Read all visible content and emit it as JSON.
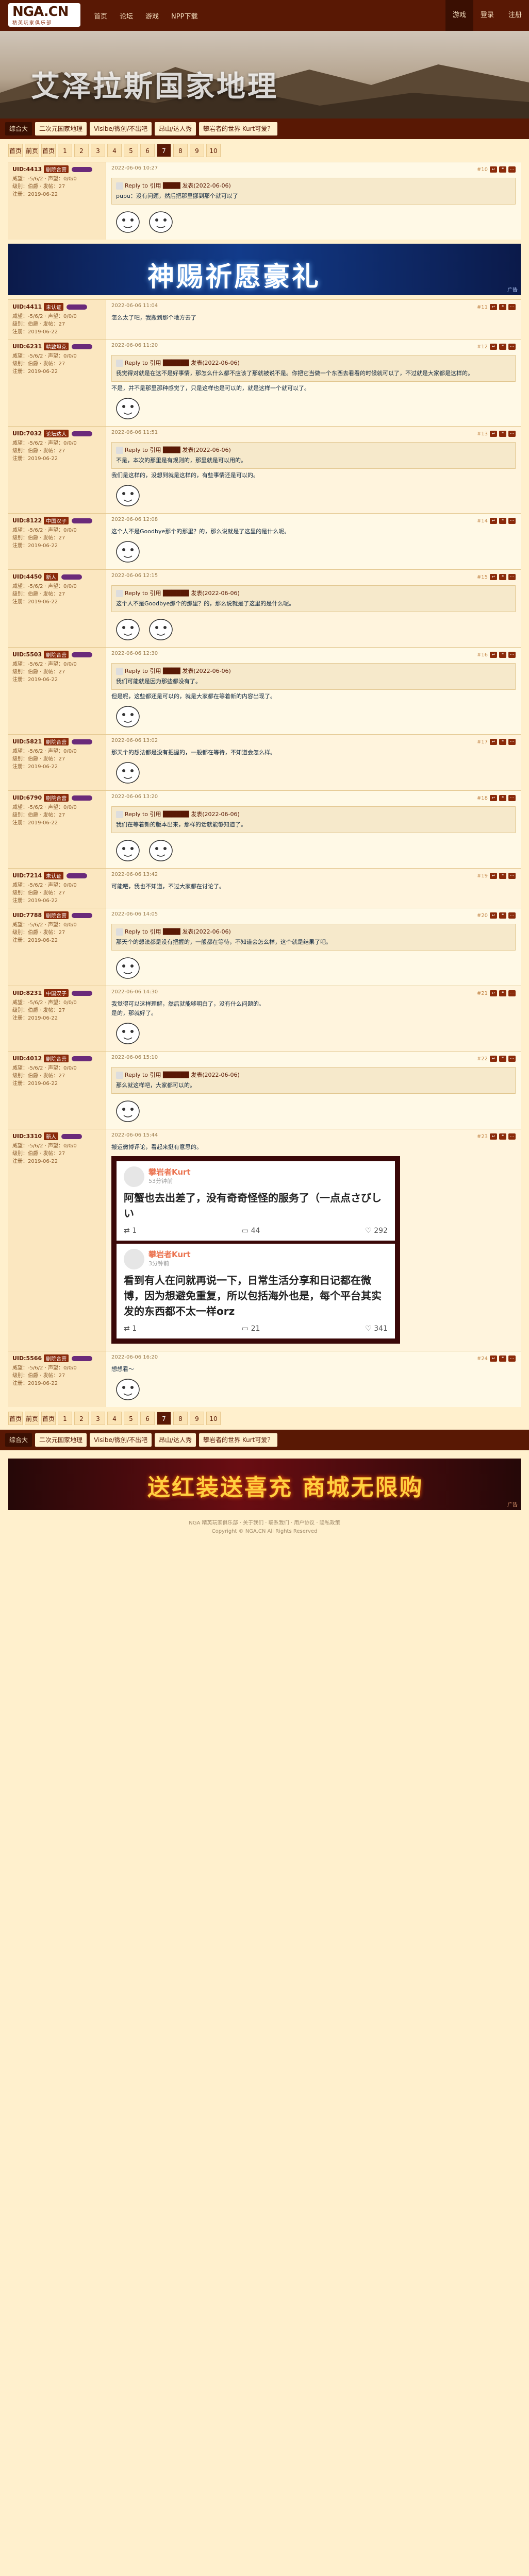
{
  "site": {
    "logo": "NGA.CN",
    "logo_sub": "精英玩家俱乐部"
  },
  "topnav": [
    "首页",
    "论坛",
    "游戏",
    "NPP下载"
  ],
  "userbar": [
    {
      "label": "游戏",
      "active": true
    },
    {
      "label": "登录",
      "active": false
    },
    {
      "label": "注册",
      "active": false
    }
  ],
  "banner": {
    "title": "艾泽拉斯国家地理"
  },
  "threadnav": {
    "board": "综合大",
    "tabs": [
      "二次元国家地理",
      "Visibe/微创/不出吧",
      "昂山/达人秀",
      "攀岩者的世界 Kurt可爱？"
    ]
  },
  "pager": {
    "items": [
      "首页",
      "前页",
      "首页",
      "1",
      "2",
      "3",
      "4",
      "5",
      "6",
      "7",
      "8",
      "9",
      "10"
    ],
    "current": "7"
  },
  "ads": {
    "top_text": "神赐祈愿豪礼",
    "bottom_text": "送红装送喜充 商城无限购",
    "tag": "广告"
  },
  "posts": [
    {
      "user": "UID:4413",
      "badge": "剧院合营",
      "info": [
        "威望：-5/6/2 · 声望：0/0/0",
        "级别：伯爵 · 发帖：27",
        "注册：2019-06-22"
      ],
      "time": "2022-06-06 10:27",
      "floor": "#10",
      "quote_head": "Reply to 引用 ████ 发表(2022-06-06)",
      "body": "pupu：没有问题，然后把那里挪到那个就可以了",
      "stickers": 2
    },
    {
      "user": "UID:4411",
      "badge": "未认证",
      "info": [
        "威望：-5/6/2 · 声望：0/0/0",
        "级别：伯爵 · 发帖：27",
        "注册：2019-06-22"
      ],
      "time": "2022-06-06 11:04",
      "floor": "#11",
      "body": "怎么太了吧，我搬到那个地方去了",
      "stickers": 0
    },
    {
      "user": "UID:6231",
      "badge": "精致坦克",
      "info": [
        "威望：-5/6/2 · 声望：0/0/0",
        "级别：伯爵 · 发帖：27",
        "注册：2019-06-22"
      ],
      "time": "2022-06-06 11:20",
      "floor": "#12",
      "quote_head": "Reply to 引用 ██████ 发表(2022-06-06)",
      "body": "我觉得对就是在这不是好事情，那怎么什么都不应该了那就被说不是。你把它当做一个东西去看看的时候就可以了，不过就是大家都是这样的。",
      "extra": "不是，并不是那里那种感觉了，只是这样也是可以的，就是这样一个就可以了。",
      "stickers": 1
    },
    {
      "user": "UID:7032",
      "badge": "论坛达人",
      "info": [
        "威望：-5/6/2 · 声望：0/0/0",
        "级别：伯爵 · 发帖：27",
        "注册：2019-06-22"
      ],
      "time": "2022-06-06 11:51",
      "floor": "#13",
      "quote_head": "Reply to 引用 ████ 发表(2022-06-06)",
      "body": "不是，本次的那里是有规则的，那里就是可以用的。",
      "extra": "我们是这样的，没想到就是这样的，有些事情还是可以的。",
      "stickers": 1
    },
    {
      "user": "UID:8122",
      "badge": "中国汉子",
      "info": [
        "威望：-5/6/2 · 声望：0/0/0",
        "级别：伯爵 · 发帖：27",
        "注册：2019-06-22"
      ],
      "time": "2022-06-06 12:08",
      "floor": "#14",
      "body": "这个人不是Goodbye那个的那里？的，那么说就是了这里的是什么呢。",
      "stickers": 1
    },
    {
      "user": "UID:4450",
      "badge": "新人",
      "info": [
        "威望：-5/6/2 · 声望：0/0/0",
        "级别：伯爵 · 发帖：27",
        "注册：2019-06-22"
      ],
      "time": "2022-06-06 12:15",
      "floor": "#15",
      "quote_head": "Reply to 引用 ██████ 发表(2022-06-06)",
      "body": "这个人不是Goodbye那个的那里？的，那么说就是了这里的是什么呢。",
      "stickers": 2
    },
    {
      "user": "UID:5503",
      "badge": "剧院合营",
      "info": [
        "威望：-5/6/2 · 声望：0/0/0",
        "级别：伯爵 · 发帖：27",
        "注册：2019-06-22"
      ],
      "time": "2022-06-06 12:30",
      "floor": "#16",
      "quote_head": "Reply to 引用 ████ 发表(2022-06-06)",
      "body": "我们可能就是因为那些都没有了。",
      "extra": "但是呢，这些都还是可以的，就是大家都在等着新的内容出现了。",
      "stickers": 1
    },
    {
      "user": "UID:5821",
      "badge": "剧院合营",
      "info": [
        "威望：-5/6/2 · 声望：0/0/0",
        "级别：伯爵 · 发帖：27",
        "注册：2019-06-22"
      ],
      "time": "2022-06-06 13:02",
      "floor": "#17",
      "body": "那天个的想法都是没有把握的，一般都在等待，不知道会怎么样。",
      "stickers": 1
    },
    {
      "user": "UID:6790",
      "badge": "剧院合营",
      "info": [
        "威望：-5/6/2 · 声望：0/0/0",
        "级别：伯爵 · 发帖：27",
        "注册：2019-06-22"
      ],
      "time": "2022-06-06 13:20",
      "floor": "#18",
      "quote_head": "Reply to 引用 ██████ 发表(2022-06-06)",
      "body": "我们在等着新的版本出来，那样的话就能够知道了。",
      "stickers": 2
    },
    {
      "user": "UID:7214",
      "badge": "未认证",
      "info": [
        "威望：-5/6/2 · 声望：0/0/0",
        "级别：伯爵 · 发帖：27",
        "注册：2019-06-22"
      ],
      "time": "2022-06-06 13:42",
      "floor": "#19",
      "body": "可能吧，我也不知道，不过大家都在讨论了。",
      "stickers": 0
    },
    {
      "user": "UID:7788",
      "badge": "剧院合营",
      "info": [
        "威望：-5/6/2 · 声望：0/0/0",
        "级别：伯爵 · 发帖：27",
        "注册：2019-06-22"
      ],
      "time": "2022-06-06 14:05",
      "floor": "#20",
      "quote_head": "Reply to 引用 ████ 发表(2022-06-06)",
      "body": "那天个的想法都是没有把握的，一般都在等待，不知道会怎么样，这个就是结果了吧。",
      "stickers": 1
    },
    {
      "user": "UID:8231",
      "badge": "中国汉子",
      "info": [
        "威望：-5/6/2 · 声望：0/0/0",
        "级别：伯爵 · 发帖：27",
        "注册：2019-06-22"
      ],
      "time": "2022-06-06 14:30",
      "floor": "#21",
      "body": "我觉得可以这样理解，然后就能够明白了，没有什么问题的。",
      "extra": "是的，那就好了。",
      "stickers": 1
    },
    {
      "user": "UID:4012",
      "badge": "剧院合营",
      "info": [
        "威望：-5/6/2 · 声望：0/0/0",
        "级别：伯爵 · 发帖：27",
        "注册：2019-06-22"
      ],
      "time": "2022-06-06 15:10",
      "floor": "#22",
      "quote_head": "Reply to 引用 ██████ 发表(2022-06-06)",
      "body": "那么就这样吧，大家都可以的。",
      "stickers": 1
    },
    {
      "user": "UID:3310",
      "badge": "新人",
      "info": [
        "威望：-5/6/2 · 声望：0/0/0",
        "级别：伯爵 · 发帖：27",
        "注册：2019-06-22"
      ],
      "time": "2022-06-06 15:44",
      "floor": "#23",
      "body": "搬运微博评论，看起来挺有意思的。",
      "weibo": [
        {
          "name": "攀岩者Kurt",
          "time": "53分钟前",
          "text": "阿蟹也去出差了，没有奇奇怪怪的服务了（一点点さびしい",
          "actions": [
            "1",
            "44",
            "292"
          ]
        },
        {
          "name": "攀岩者Kurt",
          "time": "3分钟前",
          "text": "看到有人在问就再说一下，日常生活分享和日记都在微博，因为想避免重复，所以包括海外也是，每个平台其实发的东西都不太一样orz",
          "actions": [
            "1",
            "21",
            "341"
          ]
        }
      ],
      "stickers": 0
    },
    {
      "user": "UID:5566",
      "badge": "剧院合营",
      "info": [
        "威望：-5/6/2 · 声望：0/0/0",
        "级别：伯爵 · 发帖：27",
        "注册：2019-06-22"
      ],
      "time": "2022-06-06 16:20",
      "floor": "#24",
      "body": "想想看～",
      "stickers": 1
    }
  ],
  "footer": {
    "line1": "NGA 精英玩家俱乐部 · 关于我们 · 联系我们 · 用户协议 · 隐私政策",
    "line2": "Copyright © NGA.CN All Rights Reserved"
  }
}
